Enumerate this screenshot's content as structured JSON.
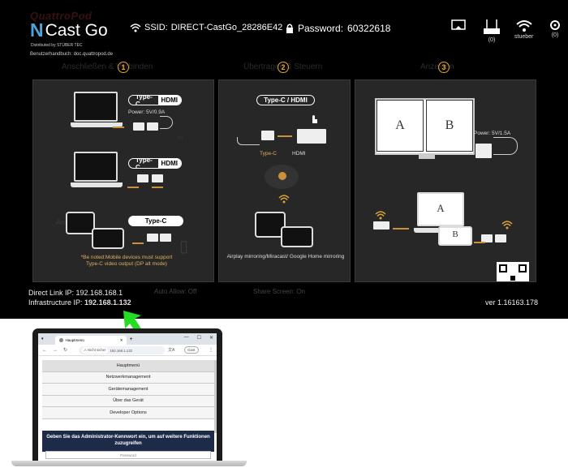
{
  "brand": {
    "ghost_text": "QuattroPod",
    "mark": "N",
    "name": "Cast Go",
    "distributed": "Distributed by  STÜBER TEC",
    "manual": "Benutzerhandbuch: doc.quattropod.de"
  },
  "network": {
    "ssid_label": "SSID:",
    "ssid": "DIRECT-CastGo_28286E42",
    "password_label": "Password:",
    "password": "60322618"
  },
  "status_icons": [
    {
      "name": "cast-icon",
      "label": ""
    },
    {
      "name": "router-icon",
      "label": "(0)"
    },
    {
      "name": "wifi-icon",
      "label": "stueber"
    },
    {
      "name": "settings-icon",
      "label": "(0)"
    }
  ],
  "steps": [
    {
      "num": "1",
      "title": "Anschließen & Verbinden"
    },
    {
      "num": "2",
      "title": "Übertragen & Steuern"
    },
    {
      "num": "3",
      "title": "Anzeigen"
    }
  ],
  "panel1": {
    "pill1_a": "Type-C",
    "pill1_b": "HDMI",
    "power": "Power: 5V/0.9A",
    "pill2_a": "Type-C",
    "pill2_b": "HDMI",
    "ghost_android": "Android",
    "pill3": "Type-C",
    "note": "*Be noted:Mobile devices must support Type-C video output (DP alt mode)"
  },
  "panel2": {
    "pill": "Type-C / HDMI",
    "label_typec": "Type-C",
    "label_hdmi": "HDMI",
    "caption": "Airplay mirroring/Miracast/ Google Home mirroring"
  },
  "panel3": {
    "screen_a": "A",
    "screen_b": "B",
    "power": "Power: 5V/1.5A",
    "small_a": "A",
    "small_b": "B"
  },
  "footer": {
    "direct_label": "Direct Link IP:",
    "direct_ip": "192.168.168.1",
    "infra_label": "Infrastructure IP:",
    "infra_ip": "192.168.1.132",
    "auto_allow": "Auto Allow: Off",
    "share_screen": "Share Screen: On",
    "version": "ver 1.16163.178"
  },
  "browser": {
    "tab_title": "Hauptmenü",
    "url_security": "Nicht sicher",
    "url": "192.168.1.132",
    "profile_btn": "Gast",
    "menu_items": [
      "Hauptmenü",
      "Netzwerkmanagement",
      "Gerätemanagement",
      "Über das Gerät",
      "Developer Options"
    ],
    "admin_msg": "Geben Sie das Administrator-Kennwort ein, um auf weitere Funktionen zuzugreifen",
    "password_placeholder": "Password"
  },
  "colors": {
    "accent_orange": "#e0a33a",
    "brand_blue": "#4da3d9",
    "arrow_green": "#22dd22",
    "admin_bg": "#1d2a48"
  }
}
